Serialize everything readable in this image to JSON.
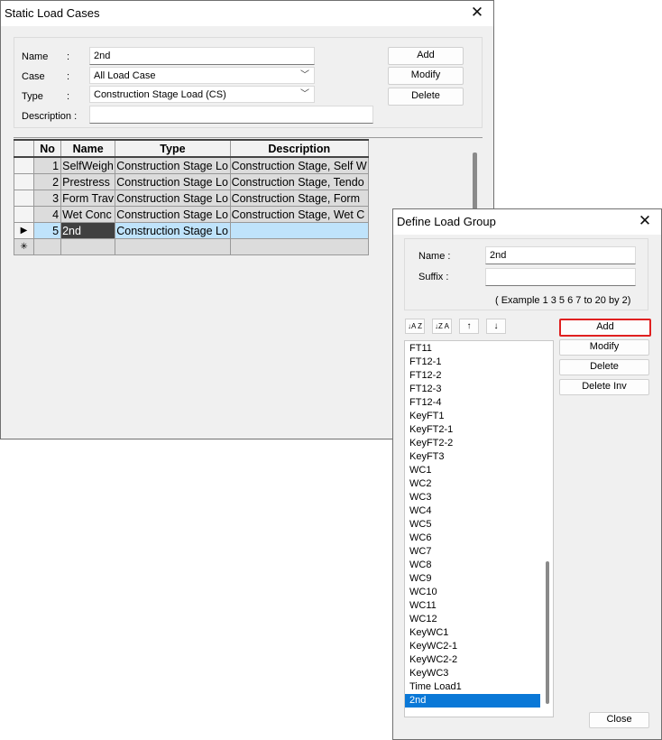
{
  "static_window": {
    "title": "Static Load Cases",
    "close": "✕",
    "name_label": "Name",
    "colon": ":",
    "name_value": "2nd",
    "case_label": "Case",
    "case_value": "All Load Case",
    "type_label": "Type",
    "type_value": "Construction Stage Load (CS)",
    "description_label": "Description :",
    "description_value": "",
    "add_label": "Add",
    "modify_label": "Modify",
    "delete_label": "Delete",
    "table": {
      "headers": [
        "No",
        "Name",
        "Type",
        "Description"
      ],
      "rows": [
        {
          "no": "1",
          "name": "SelfWeigh",
          "type": "Construction Stage Lo",
          "desc": "Construction Stage, Self W"
        },
        {
          "no": "2",
          "name": "Prestress",
          "type": "Construction Stage Lo",
          "desc": "Construction Stage, Tendo"
        },
        {
          "no": "3",
          "name": "Form Trav",
          "type": "Construction Stage Lo",
          "desc": "Construction Stage, Form"
        },
        {
          "no": "4",
          "name": "Wet Conc",
          "type": "Construction Stage Lo",
          "desc": "Construction Stage, Wet C"
        },
        {
          "no": "5",
          "name": "2nd",
          "type": "Construction Stage Lo",
          "desc": ""
        }
      ],
      "current_marker": "▶",
      "new_marker": "✳"
    }
  },
  "group_window": {
    "title": "Define Load Group",
    "close": "✕",
    "name_label": "Name  :",
    "name_value": "2nd",
    "suffix_label": "Suffix  :",
    "suffix_value": "",
    "example_text": "( Example 1 3 5 6 7 to 20 by 2)",
    "sort_asc_glyph": "↓A Z",
    "sort_desc_glyph": "↓Z A",
    "up_glyph": "↑",
    "down_glyph": "↓",
    "add_label": "Add",
    "modify_label": "Modify",
    "delete_label": "Delete",
    "delete_inv_label": "Delete Inv",
    "close_label": "Close",
    "items": [
      "FT11",
      "FT12-1",
      "FT12-2",
      "FT12-3",
      "FT12-4",
      "KeyFT1",
      "KeyFT2-1",
      "KeyFT2-2",
      "KeyFT3",
      "WC1",
      "WC2",
      "WC3",
      "WC4",
      "WC5",
      "WC6",
      "WC7",
      "WC8",
      "WC9",
      "WC10",
      "WC11",
      "WC12",
      "KeyWC1",
      "KeyWC2-1",
      "KeyWC2-2",
      "KeyWC3",
      "Time Load1",
      "2nd"
    ],
    "selected_item": "2nd"
  }
}
